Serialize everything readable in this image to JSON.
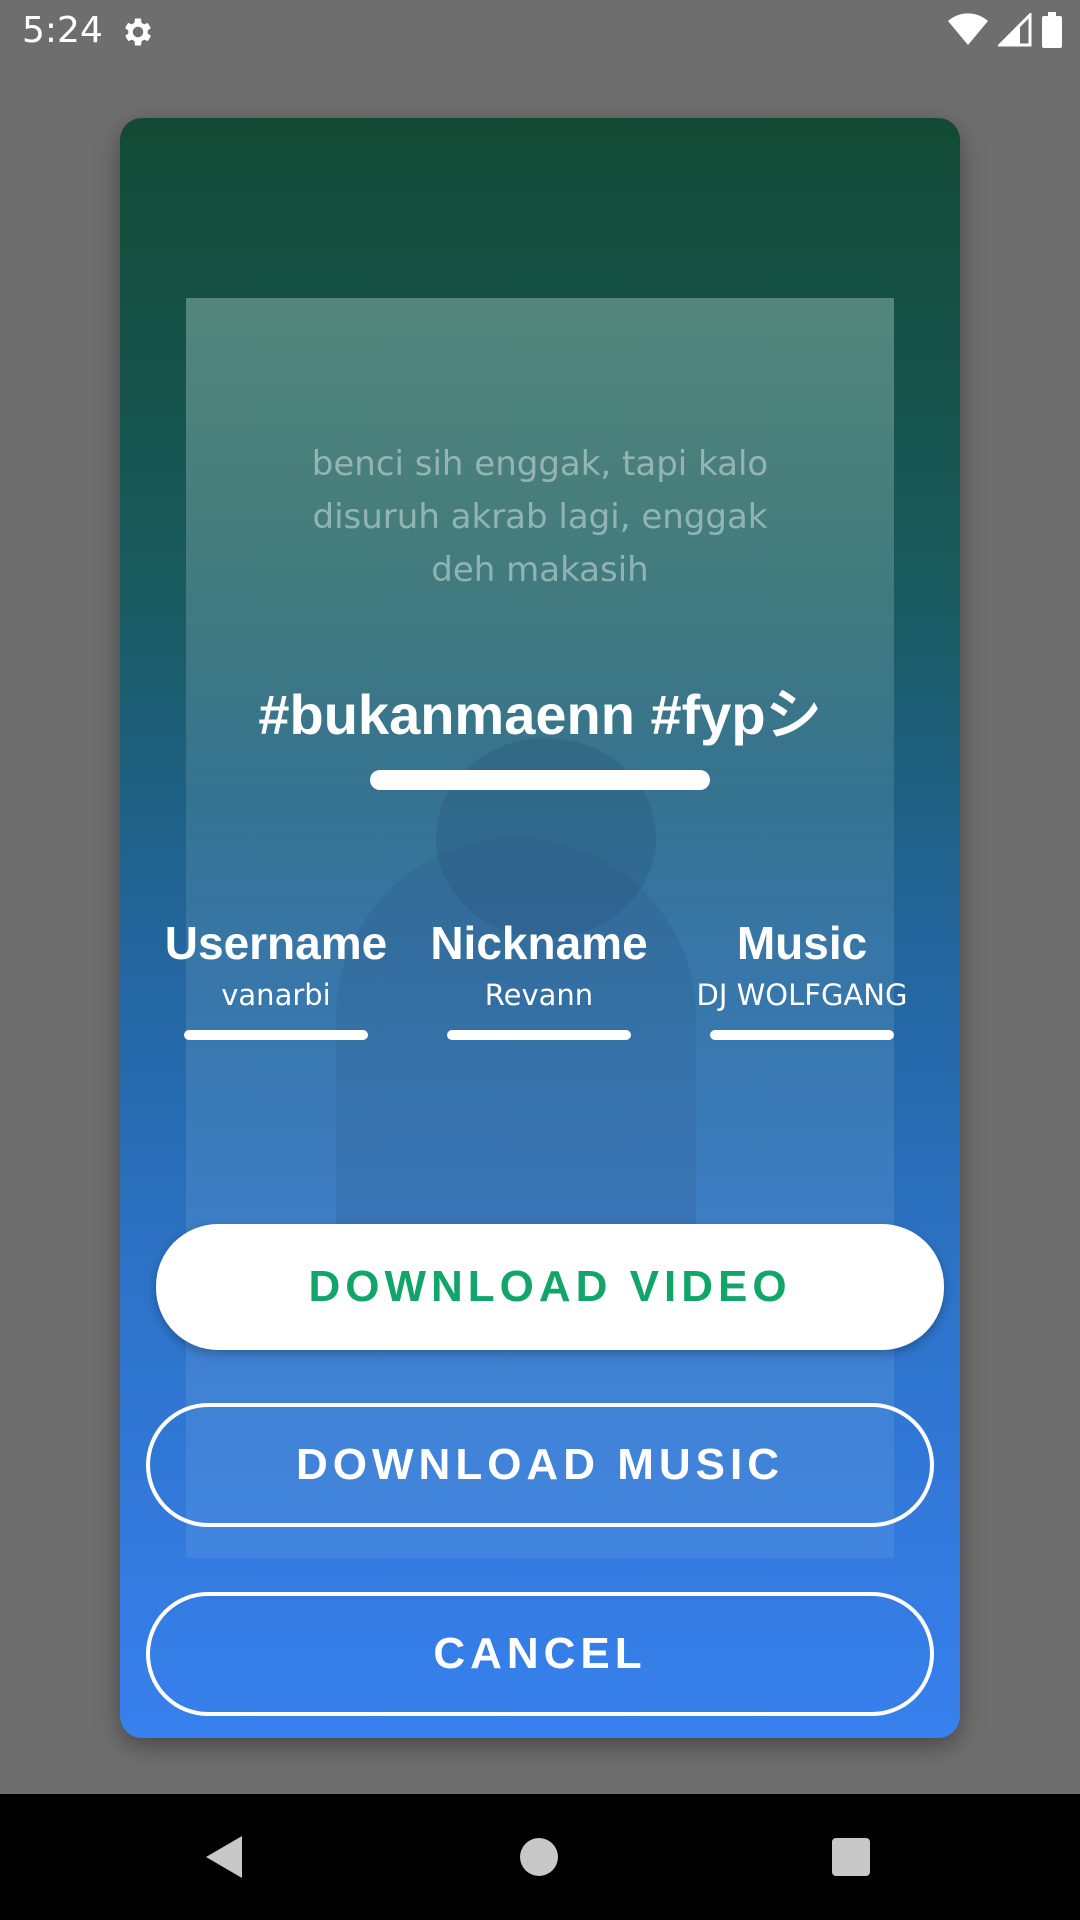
{
  "status_bar": {
    "time": "5:24",
    "icons": [
      "gear-icon",
      "wifi-icon",
      "cell-signal-icon",
      "battery-icon"
    ]
  },
  "dialog": {
    "preview_text": {
      "line1": "benci sih enggak, tapi kalo",
      "line2": "disuruh akrab lagi, enggak",
      "line3": "deh makasih"
    },
    "caption": "#bukanmaenn #fypシ",
    "info": {
      "username_label": "Username",
      "username_value": "vanarbi",
      "nickname_label": "Nickname",
      "nickname_value": "Revann",
      "music_label": "Music",
      "music_value": "DJ WOLFGANG"
    },
    "buttons": {
      "download_video": "DOWNLOAD VIDEO",
      "download_music": "DOWNLOAD MUSIC",
      "cancel": "CANCEL"
    }
  },
  "colors": {
    "accent_green": "#11a56a",
    "gradient_top": "#124a34",
    "gradient_bottom": "#3780ee",
    "scrim": "#6e6e6e"
  },
  "nav_bar": {
    "icons": [
      "back-icon",
      "home-icon",
      "recents-icon"
    ]
  }
}
